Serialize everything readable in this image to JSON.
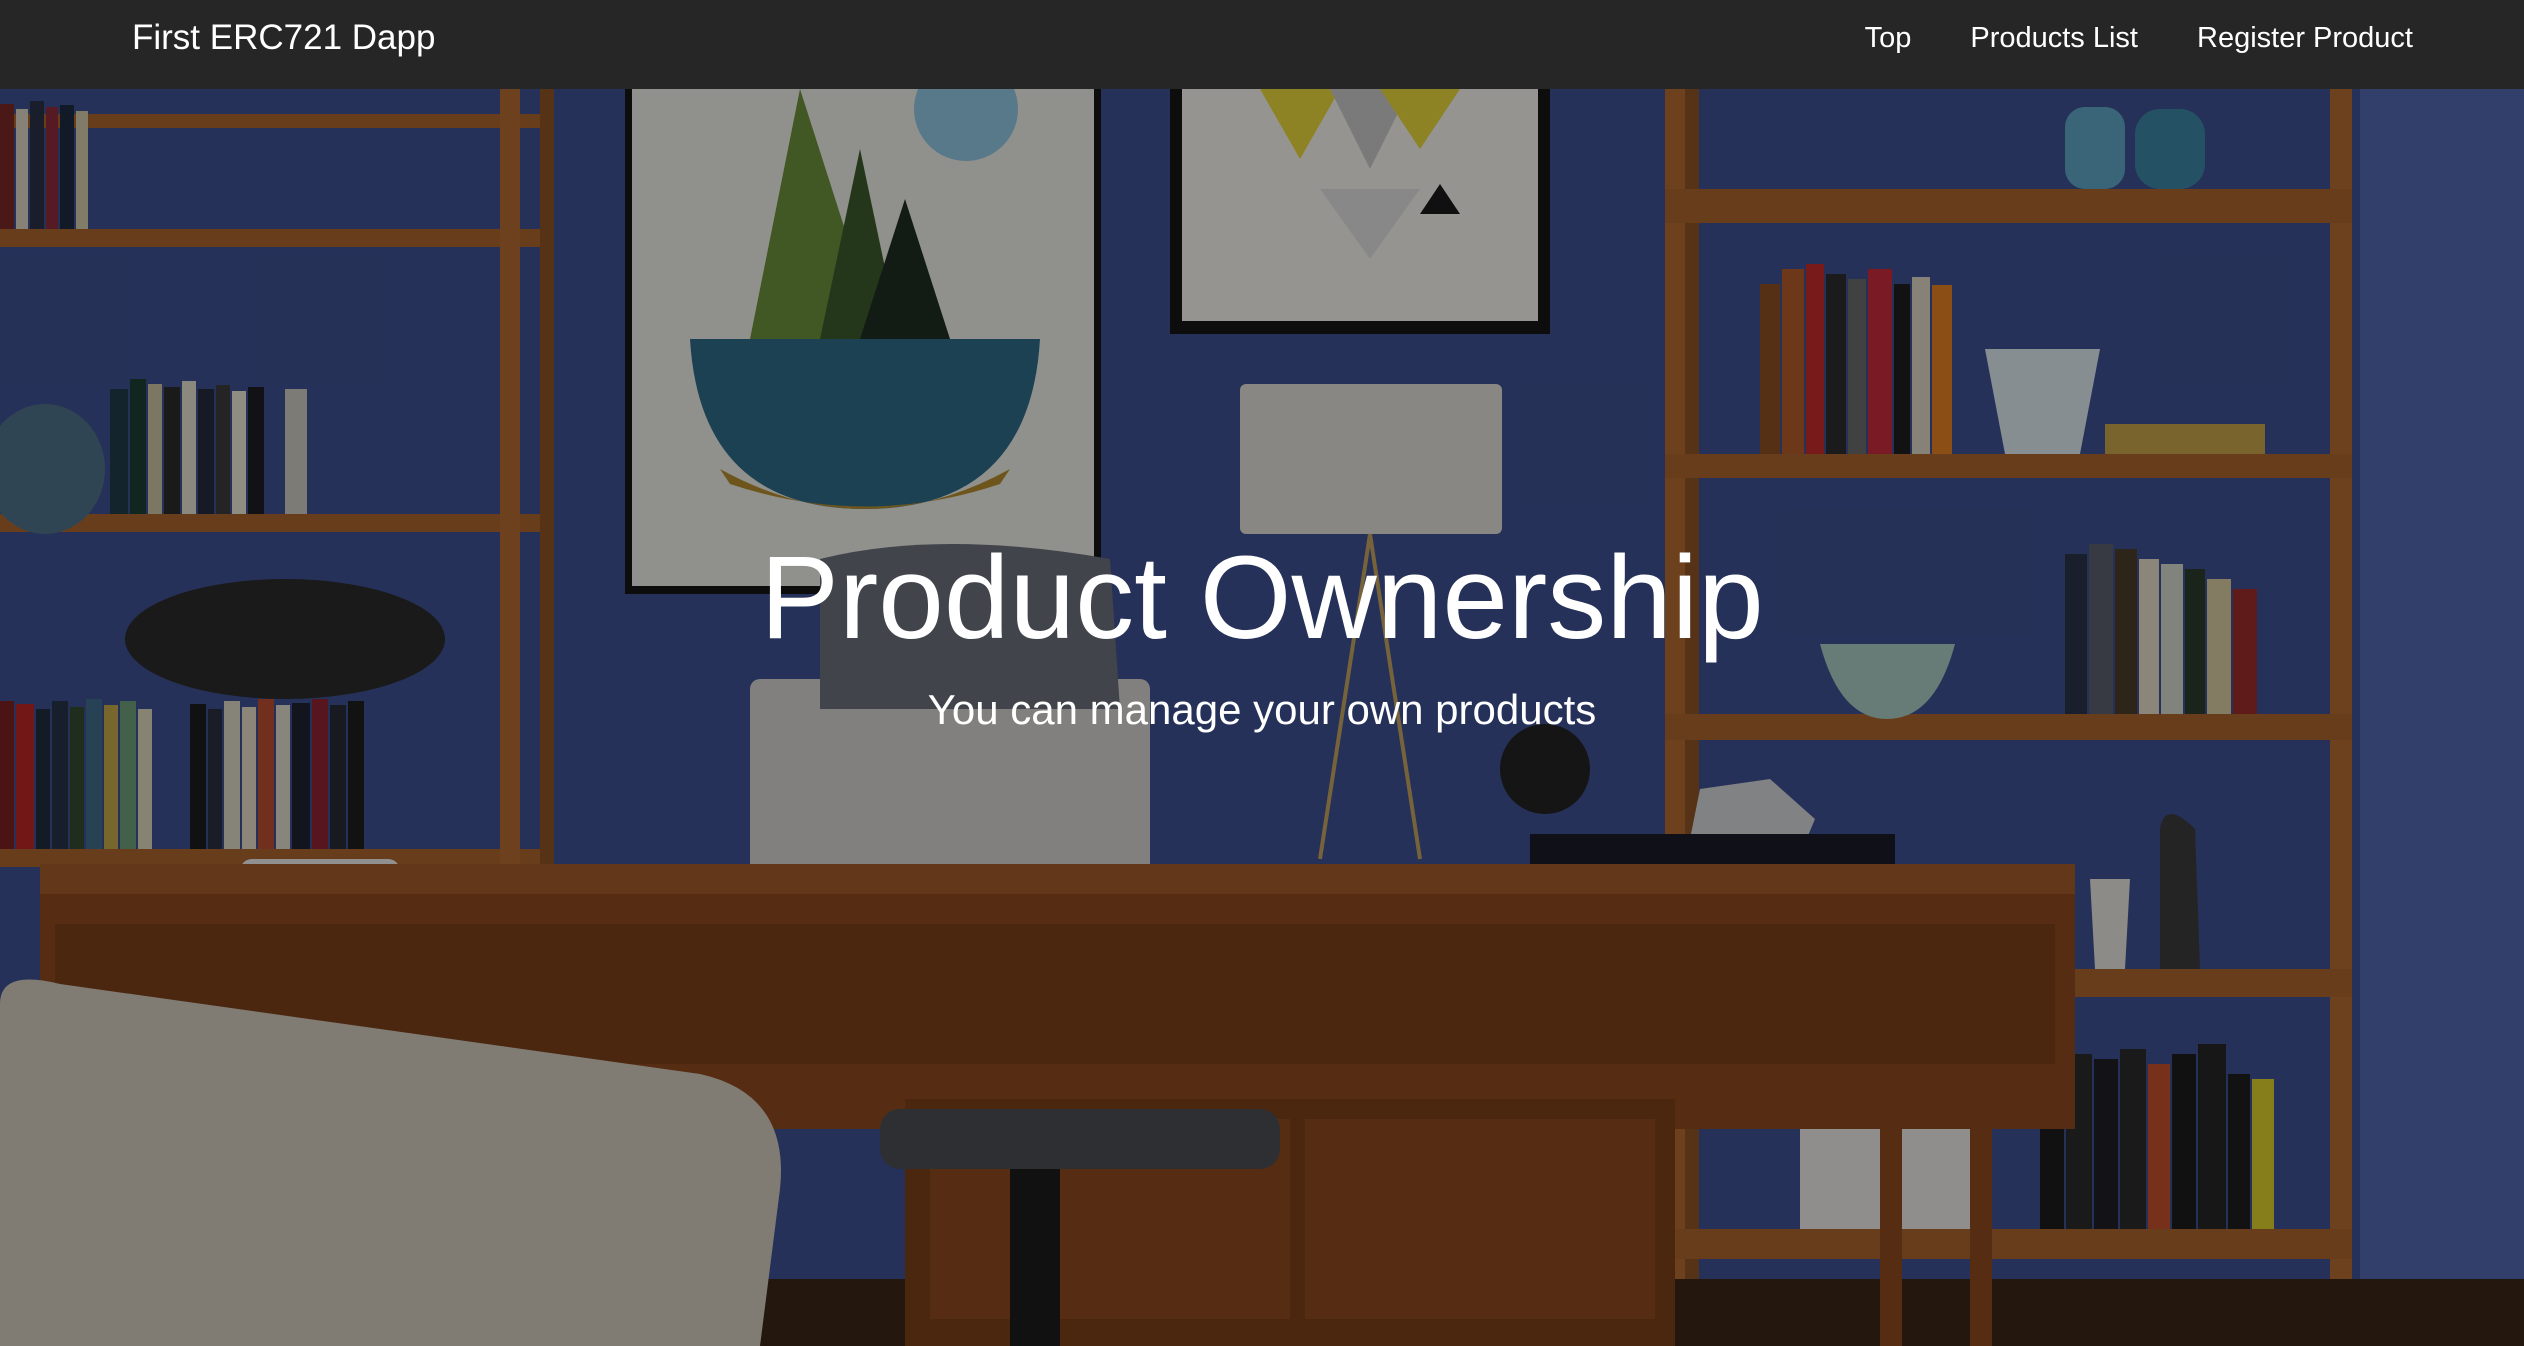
{
  "navbar": {
    "brand": "First ERC721 Dapp",
    "links": [
      {
        "label": "Top"
      },
      {
        "label": "Products List"
      },
      {
        "label": "Register Product"
      }
    ]
  },
  "hero": {
    "title": "Product Ownership",
    "subtitle": "You can manage your own products"
  },
  "colors": {
    "navbar_bg": "#262626",
    "wall_blue": "#3b4f8f",
    "wood": "#a8622c",
    "text": "#ffffff"
  }
}
